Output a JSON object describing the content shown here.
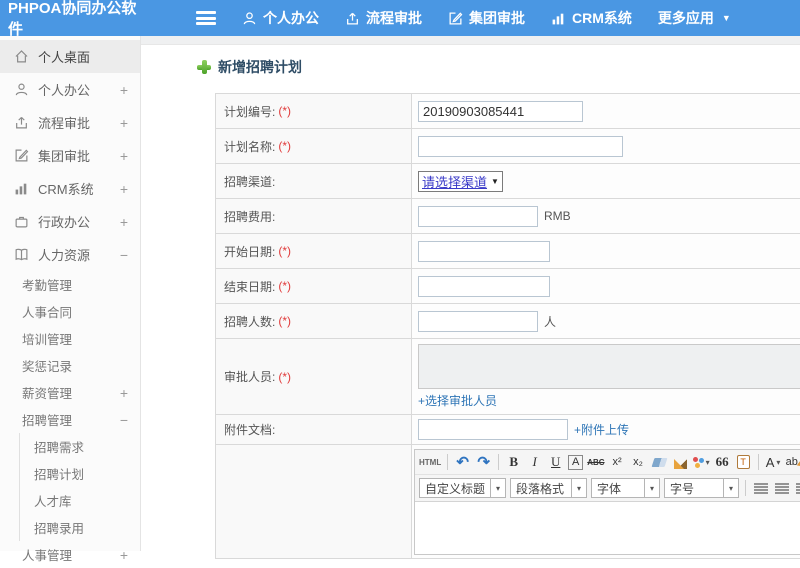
{
  "header": {
    "logo": "PHPOA协同办公软件",
    "nav": [
      {
        "label": "个人办公",
        "icon": "user-icon"
      },
      {
        "label": "流程审批",
        "icon": "share-icon"
      },
      {
        "label": "集团审批",
        "icon": "edit-icon"
      },
      {
        "label": "CRM系统",
        "icon": "chart-icon"
      },
      {
        "label": "更多应用",
        "icon": "caret-down-icon",
        "caret": "▼"
      }
    ]
  },
  "sidebar": {
    "items": [
      {
        "label": "个人桌面",
        "icon": "home-icon",
        "toggle": "",
        "active": true
      },
      {
        "label": "个人办公",
        "icon": "user-icon",
        "toggle": "+"
      },
      {
        "label": "流程审批",
        "icon": "share-icon",
        "toggle": "+"
      },
      {
        "label": "集团审批",
        "icon": "edit-icon",
        "toggle": "+"
      },
      {
        "label": "CRM系统",
        "icon": "chart-icon",
        "toggle": "+"
      },
      {
        "label": "行政办公",
        "icon": "briefcase-icon",
        "toggle": "+"
      },
      {
        "label": "人力资源",
        "icon": "book-icon",
        "toggle": "−"
      },
      {
        "label": "考勤管理",
        "toggle": ""
      },
      {
        "label": "人事合同",
        "toggle": ""
      },
      {
        "label": "培训管理",
        "toggle": ""
      },
      {
        "label": "奖惩记录",
        "toggle": ""
      },
      {
        "label": "薪资管理",
        "toggle": "+"
      },
      {
        "label": "招聘管理",
        "toggle": "−"
      },
      {
        "label": "招聘需求",
        "toggle": ""
      },
      {
        "label": "招聘计划",
        "toggle": ""
      },
      {
        "label": "人才库",
        "toggle": ""
      },
      {
        "label": "招聘录用",
        "toggle": ""
      },
      {
        "label": "人事管理",
        "toggle": "+"
      }
    ]
  },
  "main": {
    "title": "新增招聘计划",
    "form": {
      "rows": [
        {
          "label": "计划编号:",
          "req": "(*)",
          "value": "20190903085441",
          "suffix": ""
        },
        {
          "label": "计划名称:",
          "req": "(*)",
          "value": "",
          "suffix": ""
        },
        {
          "label": "招聘渠道:",
          "req": "",
          "select_value": "请选择渠道",
          "caret": "▼"
        },
        {
          "label": "招聘费用:",
          "req": "",
          "value": "",
          "suffix": "RMB"
        },
        {
          "label": "开始日期:",
          "req": "(*)",
          "value": "",
          "suffix": ""
        },
        {
          "label": "结束日期:",
          "req": "(*)",
          "value": "",
          "suffix": ""
        },
        {
          "label": "招聘人数:",
          "req": "(*)",
          "value": "",
          "suffix": "人"
        },
        {
          "label": "审批人员:",
          "req": "(*)",
          "link": "+选择审批人员"
        },
        {
          "label": "附件文档:",
          "req": "",
          "value": "",
          "link": "+附件上传"
        }
      ]
    },
    "editor": {
      "buttons": {
        "html": "HTML",
        "undo": "↶",
        "redo": "↷",
        "bold": "B",
        "italic": "I",
        "underline": "U",
        "fontbox": "A",
        "strike": "ABC",
        "sup": "x²",
        "sub": "x₂",
        "quote": "66",
        "paste": "T",
        "fontcolor": "A",
        "highlight": "ab",
        "caret": "▾"
      },
      "dropdowns": [
        {
          "label": "自定义标题"
        },
        {
          "label": "段落格式"
        },
        {
          "label": "字体"
        },
        {
          "label": "字号"
        }
      ],
      "link_glyph": "∞"
    }
  },
  "colors": {
    "header_blue": "#4a97e3",
    "link_blue": "#2e75b6",
    "required_red": "#e03b3b",
    "plus_green": "#5cb335",
    "select_text_blue": "#3a3ac8"
  }
}
